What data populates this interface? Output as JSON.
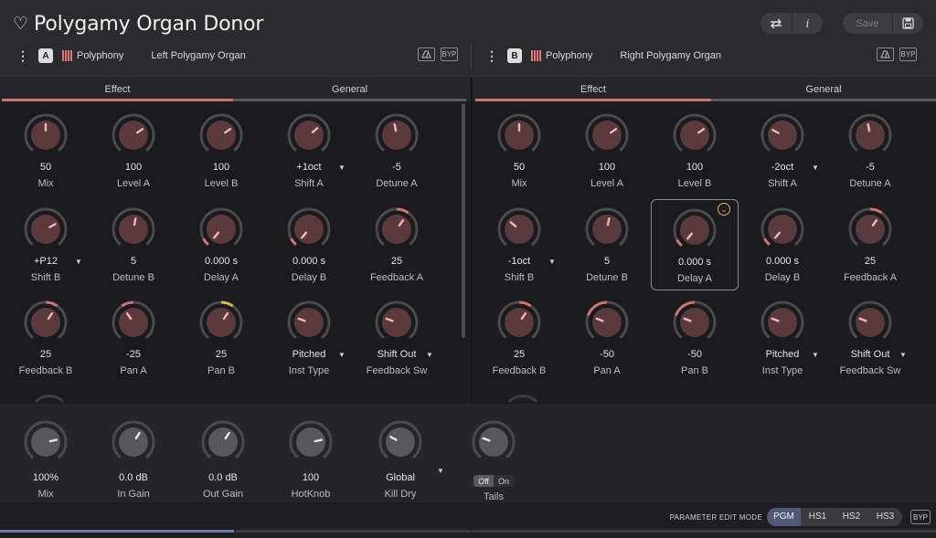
{
  "app": {
    "title": "Polygamy Organ Donor"
  },
  "header": {
    "info_label": "i",
    "save_label": "Save"
  },
  "colors": {
    "accent": "#c97474",
    "knob_body": "#5a3a3c",
    "knob_grey": "#58585c",
    "track": "#4a4a4d",
    "hotknob": "#e2b84a",
    "mode_active": "#505a78"
  },
  "slots": [
    {
      "letter": "A",
      "type": "Polyphony",
      "name": "Left Polygamy Organ",
      "byp": "BYP"
    },
    {
      "letter": "B",
      "type": "Polyphony",
      "name": "Right Polygamy Organ",
      "byp": "BYP"
    }
  ],
  "tabs": {
    "effect": "Effect",
    "general": "General"
  },
  "panels": [
    {
      "knobs": [
        {
          "value": "50",
          "label": "Mix",
          "level": 0.5
        },
        {
          "value": "100",
          "label": "Level A",
          "level": 0.7
        },
        {
          "value": "100",
          "label": "Level B",
          "level": 0.7
        },
        {
          "value": "+1oct",
          "label": "Shift A",
          "level": 0.68,
          "dropdown": true
        },
        {
          "value": "-5",
          "label": "Detune A",
          "level": 0.46
        },
        {
          "value": "+P12",
          "label": "Shift B",
          "level": 0.72,
          "dropdown": true
        },
        {
          "value": "5",
          "label": "Detune B",
          "level": 0.54
        },
        {
          "value": "0.000 s",
          "label": "Delay A",
          "level": 0.0,
          "fill": 0.0
        },
        {
          "value": "0.000 s",
          "label": "Delay B",
          "level": 0.0,
          "fill": 0.0
        },
        {
          "value": "25",
          "label": "Feedback A",
          "level": 0.625,
          "fill": 0.25
        },
        {
          "value": "25",
          "label": "Feedback B",
          "level": 0.625,
          "fill": 0.25
        },
        {
          "value": "-25",
          "label": "Pan A",
          "level": 0.375,
          "fill": -0.25
        },
        {
          "value": "25",
          "label": "Pan B",
          "level": 0.625,
          "fill": 0.25,
          "hot": true
        },
        {
          "value": "Pitched",
          "label": "Inst Type",
          "level": 0.25,
          "dropdown": true
        },
        {
          "value": "Shift Out",
          "label": "Feedback Sw",
          "level": 0.25,
          "dropdown": true
        }
      ]
    },
    {
      "knobs": [
        {
          "value": "50",
          "label": "Mix",
          "level": 0.5
        },
        {
          "value": "100",
          "label": "Level A",
          "level": 0.7
        },
        {
          "value": "100",
          "label": "Level B",
          "level": 0.7
        },
        {
          "value": "-2oct",
          "label": "Shift A",
          "level": 0.28,
          "dropdown": true
        },
        {
          "value": "-5",
          "label": "Detune A",
          "level": 0.46
        },
        {
          "value": "-1oct",
          "label": "Shift B",
          "level": 0.32,
          "dropdown": true
        },
        {
          "value": "5",
          "label": "Detune B",
          "level": 0.54
        },
        {
          "value": "0.000 s",
          "label": "Delay A",
          "level": 0.0,
          "fill": 0.0,
          "selected": true
        },
        {
          "value": "0.000 s",
          "label": "Delay B",
          "level": 0.0,
          "fill": 0.0
        },
        {
          "value": "25",
          "label": "Feedback A",
          "level": 0.625,
          "fill": 0.25
        },
        {
          "value": "25",
          "label": "Feedback B",
          "level": 0.625,
          "fill": 0.25
        },
        {
          "value": "-50",
          "label": "Pan A",
          "level": 0.25,
          "fill": -0.5
        },
        {
          "value": "-50",
          "label": "Pan B",
          "level": 0.25,
          "fill": -0.5
        },
        {
          "value": "Pitched",
          "label": "Inst Type",
          "level": 0.25,
          "dropdown": true
        },
        {
          "value": "Shift Out",
          "label": "Feedback Sw",
          "level": 0.25,
          "dropdown": true
        }
      ]
    }
  ],
  "bottom": [
    {
      "value": "100%",
      "label": "Mix",
      "level": 0.78
    },
    {
      "value": "0.0 dB",
      "label": "In Gain",
      "level": 0.62
    },
    {
      "value": "0.0 dB",
      "label": "Out Gain",
      "level": 0.62
    },
    {
      "value": "100",
      "label": "HotKnob",
      "level": 0.78
    },
    {
      "value": "Global",
      "label": "Kill Dry",
      "level": 0.28,
      "dropdown": true
    },
    {
      "label": "Tails",
      "level": 0.25,
      "toggle": {
        "off": "Off",
        "on": "On",
        "state": "Off"
      }
    }
  ],
  "footer": {
    "mode_label": "PARAMETER EDIT MODE",
    "modes": [
      "PGM",
      "HS1",
      "HS2",
      "HS3"
    ],
    "active_mode": "PGM",
    "byp": "BYP"
  },
  "progress": 0.25
}
